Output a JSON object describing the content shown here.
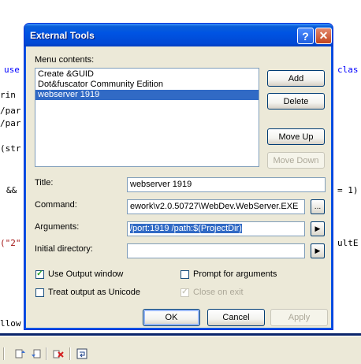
{
  "editor": {
    "lines": [
      {
        "id": "l1",
        "text": "use"
      },
      {
        "id": "l2",
        "text": "clas"
      },
      {
        "id": "l3",
        "text": "rin"
      },
      {
        "id": "l4",
        "text": "/par"
      },
      {
        "id": "l5",
        "text": "/par"
      },
      {
        "id": "l6",
        "text": "(str"
      },
      {
        "id": "l7",
        "text": "&&"
      },
      {
        "id": "l8",
        "text": "= 1)"
      },
      {
        "id": "l9",
        "text": "(\"2\""
      },
      {
        "id": "l10",
        "text": "ultE"
      },
      {
        "id": "l11",
        "text": "llow"
      }
    ]
  },
  "dialog": {
    "title": "External Tools",
    "help_glyph": "?",
    "close_glyph": "✕",
    "menu_contents_label": "Menu contents:",
    "menu_items": [
      "Create &GUID",
      "Dot&fuscator Community Edition",
      "webserver 1919"
    ],
    "selected_index": 2,
    "buttons": {
      "add": "Add",
      "delete": "Delete",
      "move_up": "Move Up",
      "move_down": "Move Down",
      "ok": "OK",
      "cancel": "Cancel",
      "apply": "Apply"
    },
    "fields": {
      "title_label": "Title:",
      "title_value": "webserver 1919",
      "command_label": "Command:",
      "command_value": "ework\\v2.0.50727\\WebDev.WebServer.EXE",
      "browse_glyph": "...",
      "arguments_label": "Arguments:",
      "arguments_value": "/port:1919 /path:$(ProjectDir)",
      "initial_directory_label": "Initial directory:",
      "initial_directory_value": "",
      "arrow_glyph": "▶"
    },
    "checks": {
      "use_output": {
        "label": "Use Output window",
        "checked": true
      },
      "prompt_args": {
        "label": "Prompt for arguments",
        "checked": false
      },
      "unicode": {
        "label": "Treat output as Unicode",
        "checked": false
      },
      "close_on_exit": {
        "label": "Close on exit",
        "checked": true
      }
    },
    "check_glyph": "✓"
  },
  "colors": {
    "titlebar": "#0054e3",
    "selection": "#316ac5",
    "dialog_face": "#ece9d8",
    "code_keyword": "#0000ff"
  }
}
